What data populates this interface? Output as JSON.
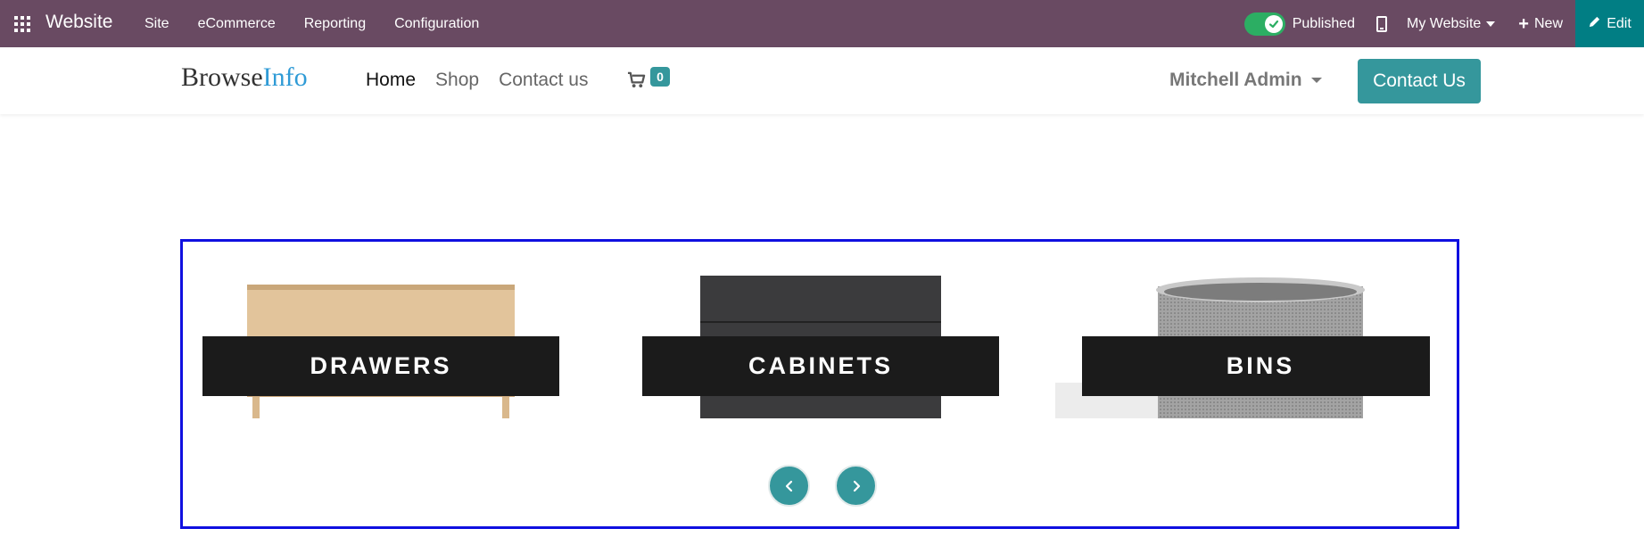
{
  "topbar": {
    "app_name": "Website",
    "menu": [
      "Site",
      "eCommerce",
      "Reporting",
      "Configuration"
    ],
    "published_label": "Published",
    "website_selector": "My Website",
    "new_label": "New",
    "edit_label": "Edit",
    "bar_color": "#694a62",
    "edit_color": "#017e84"
  },
  "site_header": {
    "logo_part1": "Browse",
    "logo_part2": "Info",
    "nav": [
      "Home",
      "Shop",
      "Contact us"
    ],
    "cart_count": "0",
    "user_name": "Mitchell Admin",
    "contact_button": "Contact Us",
    "accent_color": "#35979c"
  },
  "carousel": {
    "items": [
      {
        "caption": "DRAWERS"
      },
      {
        "caption": "CABINETS"
      },
      {
        "caption": "BINS"
      }
    ],
    "border_color": "#1010e0"
  }
}
